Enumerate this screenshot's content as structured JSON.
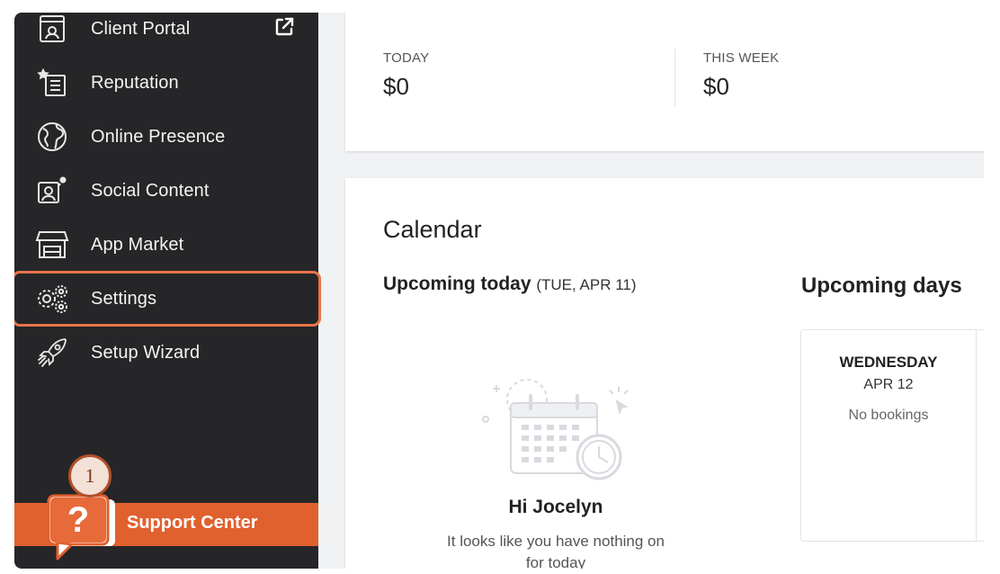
{
  "sidebar": {
    "items": [
      {
        "label": "Client Portal",
        "icon": "client-portal-icon",
        "external": true
      },
      {
        "label": "Reputation",
        "icon": "reputation-icon"
      },
      {
        "label": "Online Presence",
        "icon": "globe-icon"
      },
      {
        "label": "Social Content",
        "icon": "social-content-icon"
      },
      {
        "label": "App Market",
        "icon": "storefront-icon"
      },
      {
        "label": "Settings",
        "icon": "gears-icon",
        "selected": true
      },
      {
        "label": "Setup Wizard",
        "icon": "rocket-icon"
      }
    ],
    "support": {
      "label": "Support Center",
      "icon": "help-bubble-icon"
    },
    "step_badge": "1"
  },
  "stats": {
    "today": {
      "caption": "TODAY",
      "value": "$0"
    },
    "this_week": {
      "caption": "THIS WEEK",
      "value": "$0"
    }
  },
  "calendar": {
    "title": "Calendar",
    "upcoming_today": {
      "label": "Upcoming today",
      "date": "(TUE,  APR 11)"
    },
    "empty": {
      "greeting": "Hi Jocelyn",
      "message": "It looks like you have nothing on for today"
    },
    "upcoming_days": {
      "label": "Upcoming days",
      "days": [
        {
          "weekday": "WEDNESDAY",
          "date": "APR 12",
          "status": "No bookings"
        }
      ]
    }
  },
  "colors": {
    "sidebar_bg": "#262628",
    "accent_orange": "#e0602e",
    "selected_outline": "#e8744a"
  }
}
